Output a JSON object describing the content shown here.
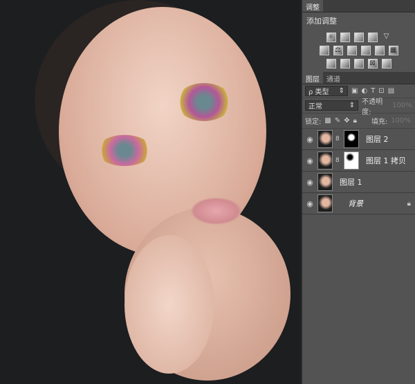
{
  "adjust_panel": {
    "tab": "调整",
    "add_label": "添加调整",
    "icons": [
      [
        "brightness-icon",
        "levels-icon",
        "curves-icon",
        "exposure-icon",
        "vibrance-icon"
      ],
      [
        "hue-saturation-icon",
        "color-balance-icon",
        "black-white-icon",
        "photo-filter-icon",
        "channel-mixer-icon",
        "color-lookup-icon"
      ],
      [
        "invert-icon",
        "posterize-icon",
        "threshold-icon",
        "selective-color-icon",
        "gradient-map-icon"
      ]
    ]
  },
  "layers_panel": {
    "tabs": [
      "图层",
      "通道"
    ],
    "filter_label": "ρ 类型",
    "blend_mode": "正常",
    "opacity_label": "不透明度:",
    "opacity_value": "100%",
    "lock_label": "锁定:",
    "fill_label": "填充:",
    "fill_value": "100%",
    "layers": [
      {
        "name": "图层 2",
        "mask": "black"
      },
      {
        "name": "图层 1 拷贝",
        "mask": "white"
      },
      {
        "name": "图层 1",
        "mask": null
      },
      {
        "name": "背景",
        "mask": null,
        "locked": true
      }
    ]
  }
}
